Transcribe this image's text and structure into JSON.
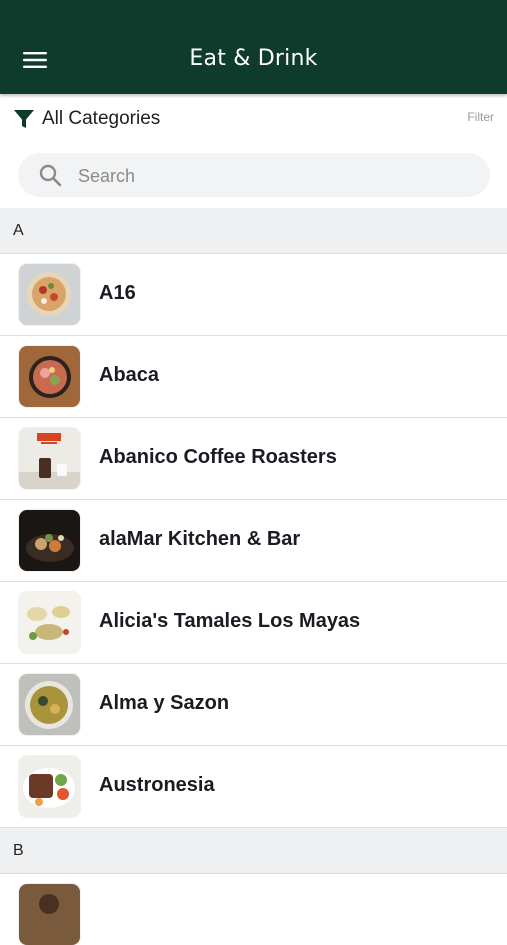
{
  "colors": {
    "appbar": "#0f3b2c",
    "section_bg": "#eff0f2",
    "accent": "#0f3b2c"
  },
  "appbar": {
    "title": "Eat & Drink",
    "menu_icon": "hamburger-menu-icon"
  },
  "filter": {
    "category_label": "All Categories",
    "filter_label": "Filter",
    "icon": "funnel-icon"
  },
  "search": {
    "placeholder": "Search",
    "value": "",
    "icon": "search-icon"
  },
  "sections": [
    {
      "letter": "A",
      "items": [
        {
          "name": "A16"
        },
        {
          "name": "Abaca"
        },
        {
          "name": "Abanico Coffee Roasters"
        },
        {
          "name": "alaMar Kitchen & Bar"
        },
        {
          "name": "Alicia's Tamales Los Mayas"
        },
        {
          "name": "Alma y Sazon"
        },
        {
          "name": "Austronesia"
        }
      ]
    },
    {
      "letter": "B",
      "items": []
    }
  ]
}
